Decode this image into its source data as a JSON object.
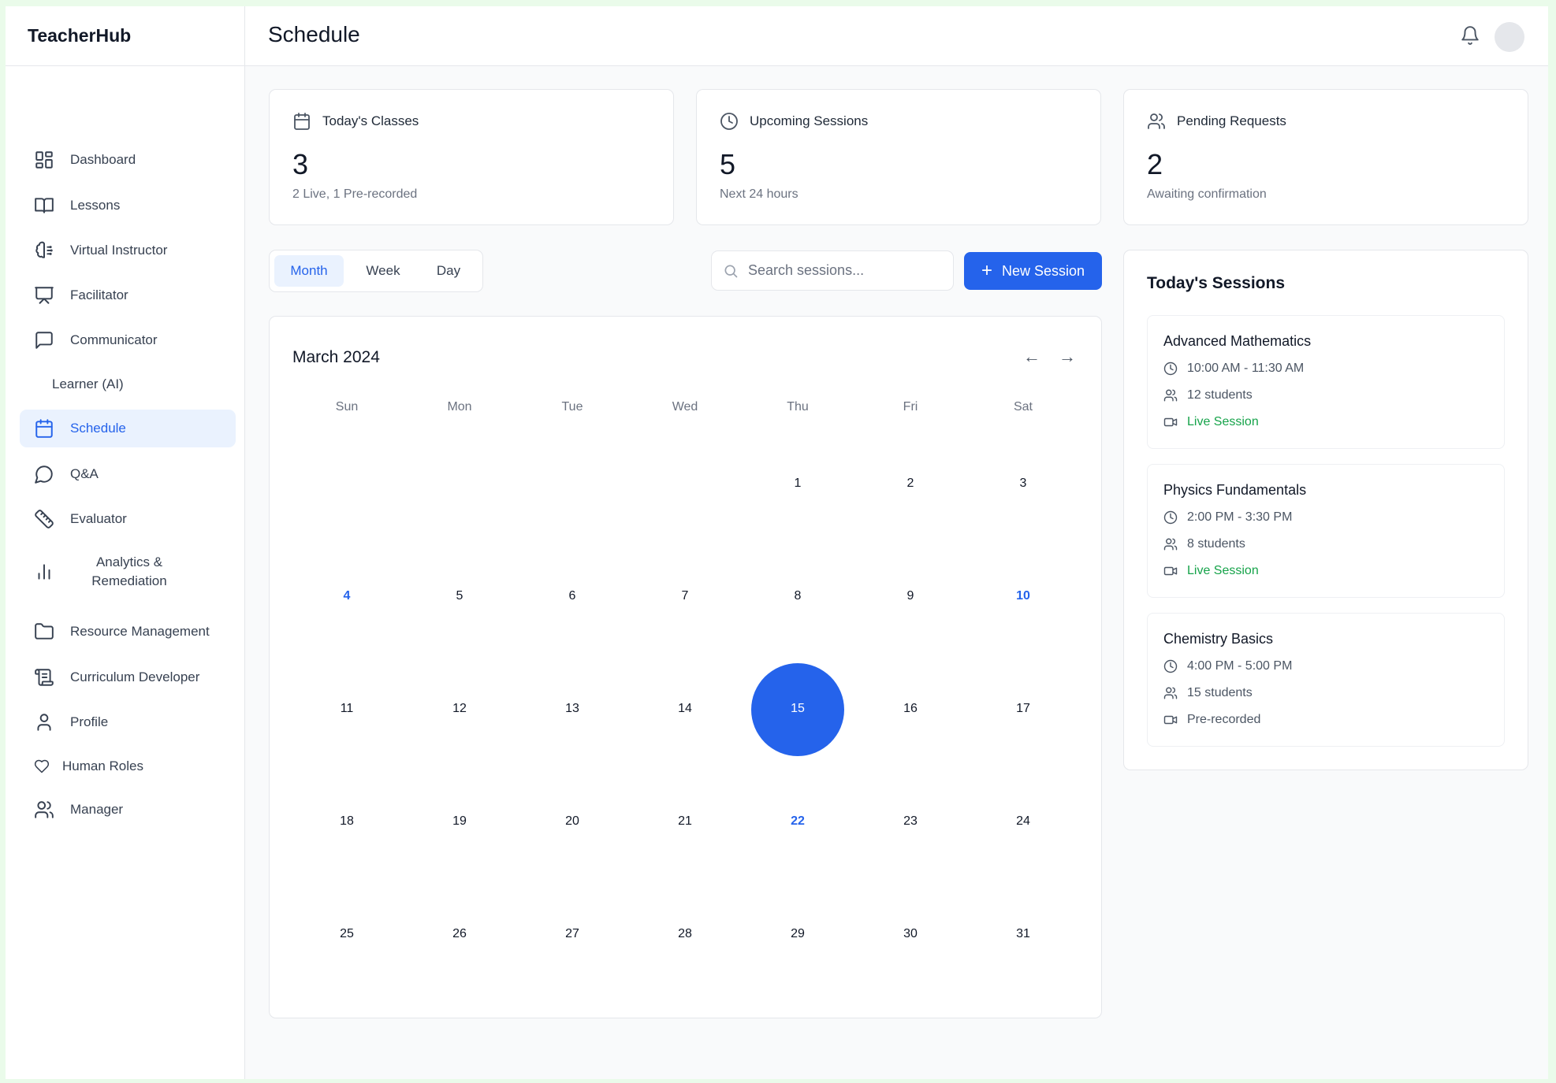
{
  "app": {
    "brand": "TeacherHub",
    "page_title": "Schedule"
  },
  "sidebar": {
    "items": [
      {
        "label": "Dashboard",
        "icon": "dashboard-icon"
      },
      {
        "label": "Lessons",
        "icon": "book-open-icon"
      },
      {
        "label": "Virtual Instructor",
        "icon": "brain-icon"
      },
      {
        "label": "Facilitator",
        "icon": "presentation-icon"
      },
      {
        "label": "Communicator",
        "icon": "message-square-icon"
      },
      {
        "label": "Learner (AI)",
        "icon": ""
      },
      {
        "label": "Schedule",
        "icon": "calendar-icon",
        "active": true
      },
      {
        "label": "Q&A",
        "icon": "message-circle-icon"
      },
      {
        "label": "Evaluator",
        "icon": "ruler-icon"
      },
      {
        "label": "Analytics & Remediation",
        "icon": "bar-chart-icon"
      },
      {
        "label": "Resource Management",
        "icon": "folder-icon"
      },
      {
        "label": "Curriculum Developer",
        "icon": "scroll-icon"
      },
      {
        "label": "Profile",
        "icon": "user-icon"
      },
      {
        "label": "Human Roles",
        "icon": "heart-icon"
      },
      {
        "label": "Manager",
        "icon": "users-icon"
      }
    ]
  },
  "stats": [
    {
      "title": "Today's Classes",
      "value": "3",
      "sub": "2 Live, 1 Pre-recorded",
      "icon": "calendar-icon"
    },
    {
      "title": "Upcoming Sessions",
      "value": "5",
      "sub": "Next 24 hours",
      "icon": "clock-icon"
    },
    {
      "title": "Pending Requests",
      "value": "2",
      "sub": "Awaiting confirmation",
      "icon": "users-icon"
    }
  ],
  "view_toggle": {
    "options": [
      "Month",
      "Week",
      "Day"
    ],
    "selected": "Month"
  },
  "search": {
    "placeholder": "Search sessions...",
    "value": ""
  },
  "new_session_label": "New Session",
  "calendar": {
    "title": "March 2024",
    "prev": "←",
    "next": "→",
    "weekdays": [
      "Sun",
      "Mon",
      "Tue",
      "Wed",
      "Thu",
      "Fri",
      "Sat"
    ],
    "first_weekday_index": 4,
    "days_in_month": 31,
    "selected_day": 15,
    "highlighted_days": [
      4,
      10,
      22
    ]
  },
  "todays_sessions": {
    "title": "Today's Sessions",
    "items": [
      {
        "name": "Advanced Mathematics",
        "time": "10:00 AM - 11:30 AM",
        "students": "12 students",
        "type": "Live Session",
        "live": true
      },
      {
        "name": "Physics Fundamentals",
        "time": "2:00 PM - 3:30 PM",
        "students": "8 students",
        "type": "Live Session",
        "live": true
      },
      {
        "name": "Chemistry Basics",
        "time": "4:00 PM - 5:00 PM",
        "students": "15 students",
        "type": "Pre-recorded",
        "live": false
      }
    ]
  },
  "colors": {
    "accent": "#2563eb",
    "live": "#16a34a",
    "active_bg": "#eaf2fe"
  }
}
